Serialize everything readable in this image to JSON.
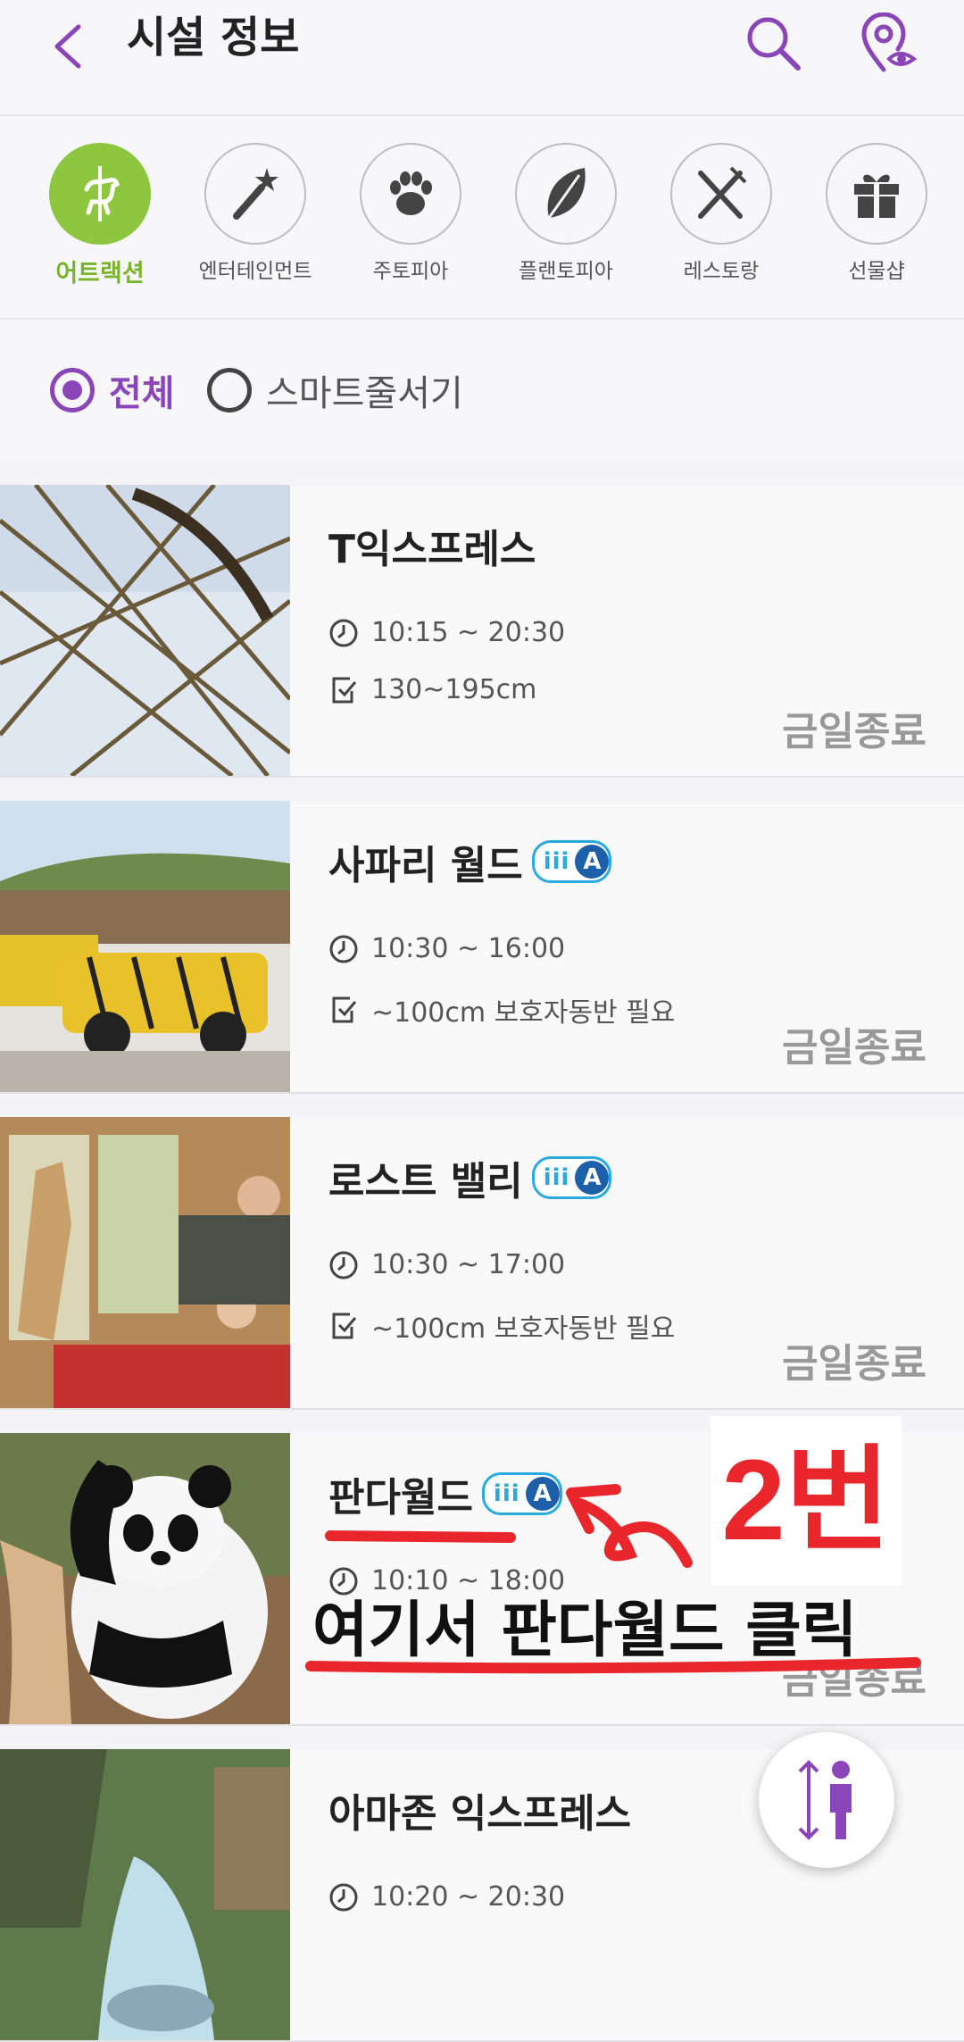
{
  "header": {
    "title": "시설 정보"
  },
  "categories": [
    {
      "label": "어트랙션",
      "icon": "carousel-horse-icon",
      "active": true
    },
    {
      "label": "엔터테인먼트",
      "icon": "magic-wand-icon",
      "active": false
    },
    {
      "label": "주토피아",
      "icon": "paw-icon",
      "active": false
    },
    {
      "label": "플랜토피아",
      "icon": "leaf-icon",
      "active": false
    },
    {
      "label": "레스토랑",
      "icon": "fork-knife-icon",
      "active": false
    },
    {
      "label": "선물샵",
      "icon": "gift-icon",
      "active": false
    }
  ],
  "filter": {
    "all_label": "전체",
    "smart_label": "스마트줄서기"
  },
  "items": [
    {
      "name": "T익스프레스",
      "time": "10:15 ~ 20:30",
      "height": "130~195cm",
      "status": "금일종료",
      "smart_queue": false
    },
    {
      "name": "사파리 월드",
      "time": "10:30 ~ 16:00",
      "height": "~100cm 보호자동반 필요",
      "status": "금일종료",
      "smart_queue": true
    },
    {
      "name": "로스트 밸리",
      "time": "10:30 ~ 17:00",
      "height": "~100cm 보호자동반 필요",
      "status": "금일종료",
      "smart_queue": true
    },
    {
      "name": "판다월드",
      "time": "10:10 ~ 18:00",
      "height": "",
      "status": "금일종료",
      "smart_queue": true
    },
    {
      "name": "아마존 익스프레스",
      "time": "10:20 ~ 20:30",
      "height": "",
      "status": "",
      "smart_queue": false
    }
  ],
  "badge": {
    "iii": "iii",
    "a": "A"
  },
  "annotation": {
    "number": "2번",
    "instruction": "여기서 판다월드 클릭"
  },
  "colors": {
    "accent_purple": "#8a46b8",
    "active_green": "#8dc63f",
    "annotation_red": "#e8262c"
  }
}
